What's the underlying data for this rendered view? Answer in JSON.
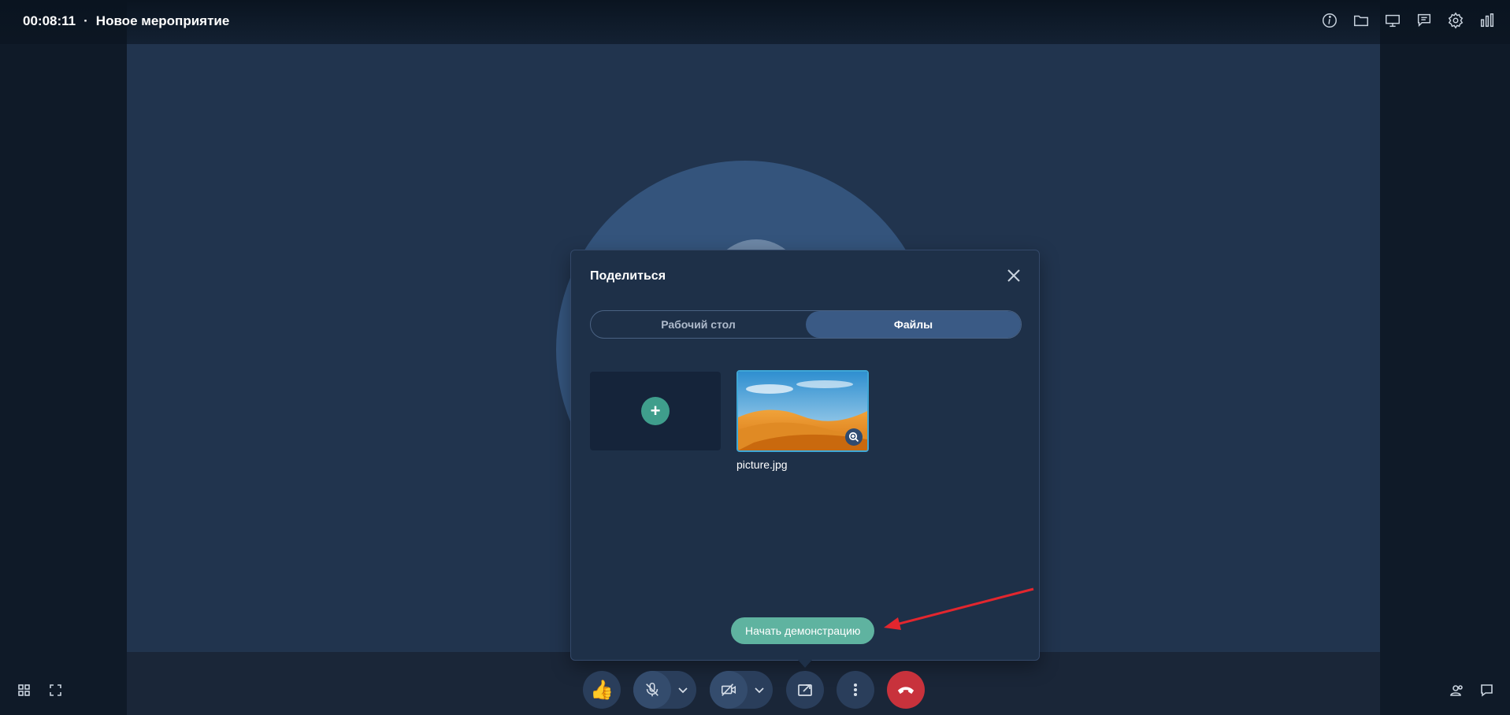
{
  "header": {
    "timer": "00:08:11",
    "separator": "·",
    "event_title": "Новое мероприятие"
  },
  "top_icons": [
    "info-icon",
    "folder-icon",
    "presentation-icon",
    "chat-icon",
    "gear-icon",
    "stats-icon"
  ],
  "dialog": {
    "title": "Поделиться",
    "tabs": [
      {
        "label": "Рабочий стол",
        "active": false
      },
      {
        "label": "Файлы",
        "active": true
      }
    ],
    "file": {
      "name": "picture.jpg"
    },
    "start_label": "Начать демонстрацию"
  },
  "controls": [
    "thumbs-up-icon",
    "mic-off-icon",
    "camera-off-icon",
    "share-screen-icon",
    "more-icon",
    "hang-up-icon"
  ],
  "colors": {
    "accent": "#5fb3a0",
    "end_call": "#c8323c",
    "arrow": "#e3262e",
    "selected_border": "#3fa7d6"
  }
}
